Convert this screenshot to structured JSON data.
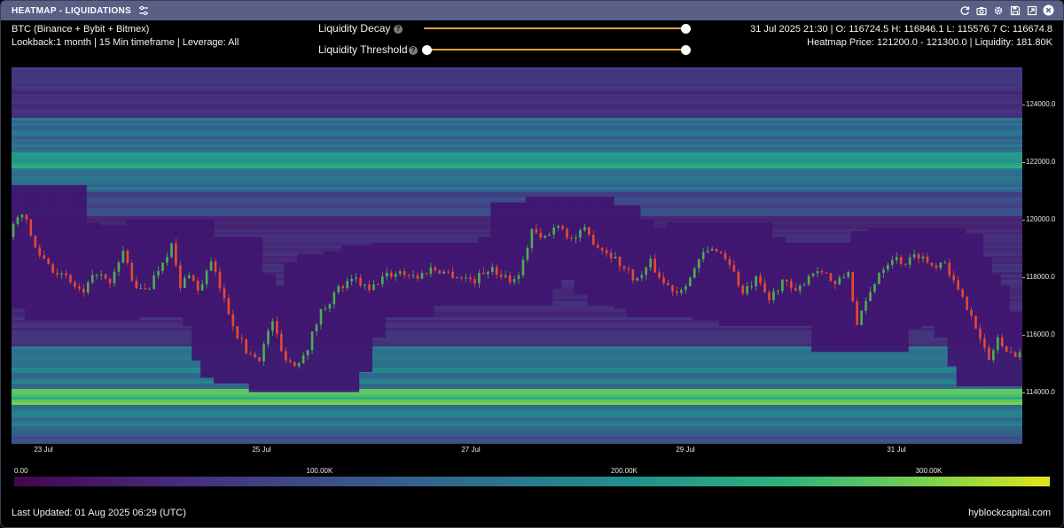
{
  "window": {
    "title": "HEATMAP - LIQUIDATIONS",
    "tools": [
      "refresh-icon",
      "camera-icon",
      "gear-icon",
      "save-icon",
      "expand-icon",
      "close-icon"
    ]
  },
  "header": {
    "symbol": "BTC (Binance + Bybit + Bitmex)",
    "settings": "Lookback:1 month | 15 Min timeframe | Leverage: All",
    "ohlc": "31 Jul 2025 21:30 | O: 116724.5 H: 116846.1 L: 115576.7 C: 116674.8",
    "heatmap_info": "Heatmap Price: 121200.0 - 121300.0 | Liquidity: 181.80K"
  },
  "controls": {
    "decay_label": "Liquidity Decay",
    "threshold_label": "Liquidity Threshold",
    "help_glyph": "?",
    "decay_value": 1.0,
    "threshold_range": [
      0.0,
      1.0
    ]
  },
  "colors": {
    "track": "#e3a33a",
    "titlebar": "#5a5f86",
    "candle_up": "#4caf50",
    "candle_down": "#e8492f"
  },
  "chart_data": {
    "type": "heatmap",
    "x_ticks": [
      "23 Jul",
      "25 Jul",
      "27 Jul",
      "29 Jul",
      "31 Jul"
    ],
    "y_ticks": [
      "124000.0",
      "122000.0",
      "120000.0",
      "118000.0",
      "116000.0",
      "114000.0"
    ],
    "ylim": [
      112200,
      125300
    ],
    "colorbar_ticks": [
      "0.00",
      "100.00K",
      "200.00K",
      "300.00K"
    ],
    "colorbar_range": [
      0,
      340000
    ],
    "price_path": [
      [
        0,
        119400
      ],
      [
        3,
        120300
      ],
      [
        6,
        119000
      ],
      [
        10,
        118300
      ],
      [
        14,
        117800
      ],
      [
        17,
        117400
      ],
      [
        20,
        118200
      ],
      [
        23,
        117700
      ],
      [
        26,
        118900
      ],
      [
        29,
        117500
      ],
      [
        32,
        117700
      ],
      [
        35,
        118600
      ],
      [
        37,
        119100
      ],
      [
        39,
        117600
      ],
      [
        41,
        118200
      ],
      [
        43,
        117500
      ],
      [
        46,
        118500
      ],
      [
        49,
        117200
      ],
      [
        52,
        116000
      ],
      [
        54,
        115400
      ],
      [
        57,
        115200
      ],
      [
        60,
        116500
      ],
      [
        62,
        115400
      ],
      [
        65,
        114900
      ],
      [
        68,
        115600
      ],
      [
        71,
        116800
      ],
      [
        75,
        117600
      ],
      [
        79,
        117900
      ],
      [
        82,
        117500
      ],
      [
        85,
        118000
      ],
      [
        89,
        118200
      ],
      [
        93,
        118000
      ],
      [
        96,
        118300
      ],
      [
        99,
        118200
      ],
      [
        103,
        118000
      ],
      [
        106,
        117900
      ],
      [
        109,
        118300
      ],
      [
        112,
        118100
      ],
      [
        115,
        117900
      ],
      [
        117,
        118500
      ],
      [
        119,
        119700
      ],
      [
        121,
        119300
      ],
      [
        123,
        119500
      ],
      [
        125,
        119900
      ],
      [
        128,
        119300
      ],
      [
        131,
        119600
      ],
      [
        134,
        119100
      ],
      [
        137,
        118800
      ],
      [
        140,
        118300
      ],
      [
        143,
        117900
      ],
      [
        146,
        118500
      ],
      [
        149,
        117800
      ],
      [
        152,
        117500
      ],
      [
        155,
        118000
      ],
      [
        158,
        118800
      ],
      [
        161,
        119000
      ],
      [
        164,
        118500
      ],
      [
        167,
        117400
      ],
      [
        170,
        117900
      ],
      [
        173,
        117200
      ],
      [
        176,
        117900
      ],
      [
        179,
        117400
      ],
      [
        182,
        118100
      ],
      [
        185,
        118300
      ],
      [
        188,
        117700
      ],
      [
        191,
        118200
      ],
      [
        193,
        116300
      ],
      [
        195,
        117100
      ],
      [
        198,
        118200
      ],
      [
        201,
        118700
      ],
      [
        204,
        118500
      ],
      [
        207,
        118800
      ],
      [
        210,
        118400
      ],
      [
        213,
        118600
      ],
      [
        215,
        117800
      ],
      [
        217,
        117200
      ],
      [
        219,
        116800
      ],
      [
        221,
        115800
      ],
      [
        223,
        115100
      ],
      [
        225,
        115900
      ],
      [
        227,
        115300
      ],
      [
        230,
        115400
      ]
    ]
  },
  "footer": {
    "updated": "Last Updated: 01 Aug 2025 06:29 (UTC)",
    "site": "hyblockcapital.com"
  }
}
